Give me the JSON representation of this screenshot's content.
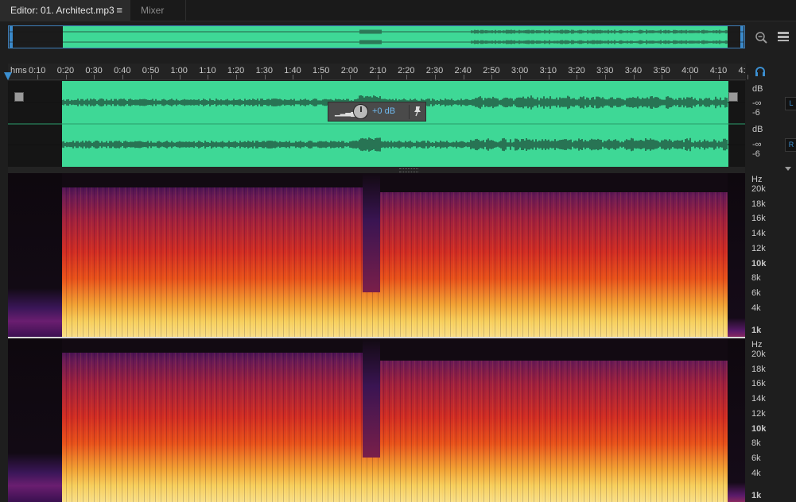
{
  "tabs": {
    "editor_label": "Editor: 01. Architect.mp3",
    "menu_icon": "≡",
    "mixer_label": "Mixer"
  },
  "toolbar": {
    "zoom_icon": "zoom-out-icon",
    "panel_icon": "panel-toggle-icon",
    "headphones_icon": "headphones-icon"
  },
  "ruler": {
    "unit": "hms",
    "labels": [
      "0:10",
      "0:20",
      "0:30",
      "0:40",
      "0:50",
      "1:00",
      "1:10",
      "1:20",
      "1:30",
      "1:40",
      "1:50",
      "2:00",
      "2:10",
      "2:20",
      "2:30",
      "2:40",
      "2:50",
      "3:00",
      "3:10",
      "3:20",
      "3:30",
      "3:40",
      "3:50",
      "4:00",
      "4:10",
      "4:"
    ]
  },
  "hud": {
    "value": "+0 dB"
  },
  "amplitude_scale": {
    "unit": "dB",
    "inf": "-∞",
    "minus6": "-6",
    "left_tag": "L",
    "right_tag": "R"
  },
  "frequency_scale": {
    "unit": "Hz",
    "labels": [
      "20k",
      "18k",
      "16k",
      "14k",
      "12k",
      "10k",
      "8k",
      "6k",
      "4k",
      "1k"
    ]
  },
  "colors": {
    "waveform": "#3ed896",
    "accent": "#3b8fd1"
  }
}
